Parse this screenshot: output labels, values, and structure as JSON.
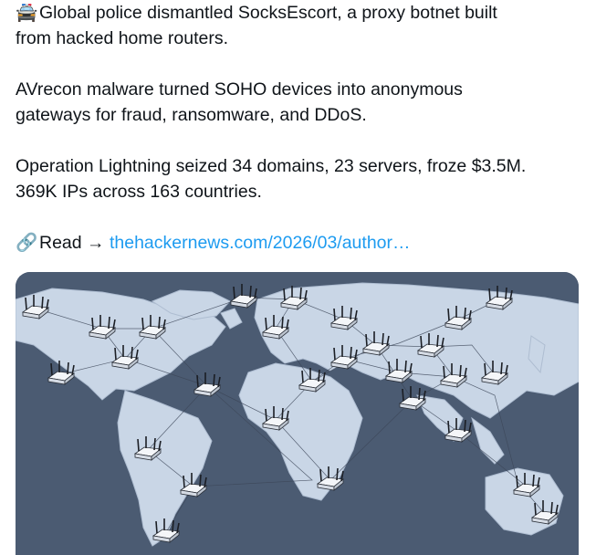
{
  "tweet": {
    "line1_emoji": "🚔",
    "line1": "Global police dismantled SocksEscort, a proxy botnet built",
    "line2": "from hacked home routers.",
    "line3": "AVrecon malware turned SOHO devices into anonymous",
    "line4": "gateways for fraud, ransomware, and DDoS.",
    "line5": "Operation Lightning seized 34 domains, 23 servers, froze $3.5M.",
    "line6": "369K IPs across 163 countries.",
    "link_emoji": "🔗",
    "read_label": "Read →",
    "link_text": "thehackernews.com/2026/03/author…"
  },
  "media": {
    "ocean_color": "#4b5b72",
    "land_color": "#c9d6e6",
    "router_icon": "router-icon"
  }
}
